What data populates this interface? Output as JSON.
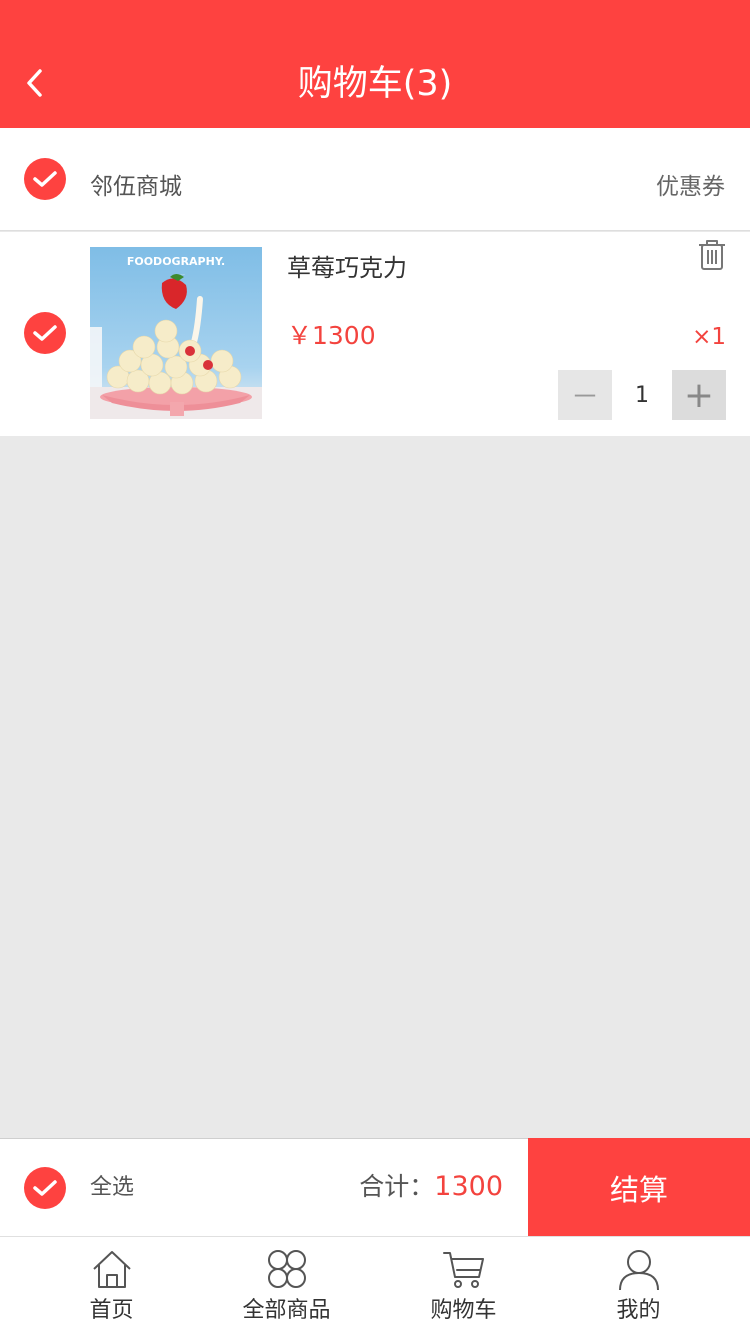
{
  "header": {
    "title": "购物车(3)",
    "back_icon": "chevron-left-icon"
  },
  "shop": {
    "name": "邻伍商城",
    "coupon_label": "优惠券",
    "check_icon": "check-circle-icon"
  },
  "items": [
    {
      "title": "草莓巧克力",
      "price": "￥1300",
      "quantity_label": "×1",
      "quantity": "1",
      "minus_label": "－",
      "plus_label": "+",
      "image_caption": "FOODOGRAPHY.",
      "image_subcaption": "..."
    }
  ],
  "footer": {
    "select_all": "全选",
    "total_label": "合计：",
    "total_value": "1300",
    "checkout_label": "结算"
  },
  "tabbar": [
    {
      "label": "首页",
      "icon": "home-icon"
    },
    {
      "label": "全部商品",
      "icon": "grid-icon"
    },
    {
      "label": "购物车",
      "icon": "cart-icon"
    },
    {
      "label": "我的",
      "icon": "user-icon"
    }
  ],
  "colors": {
    "accent": "#fe4240",
    "price": "#f3433e",
    "background": "#e9e9e9"
  }
}
